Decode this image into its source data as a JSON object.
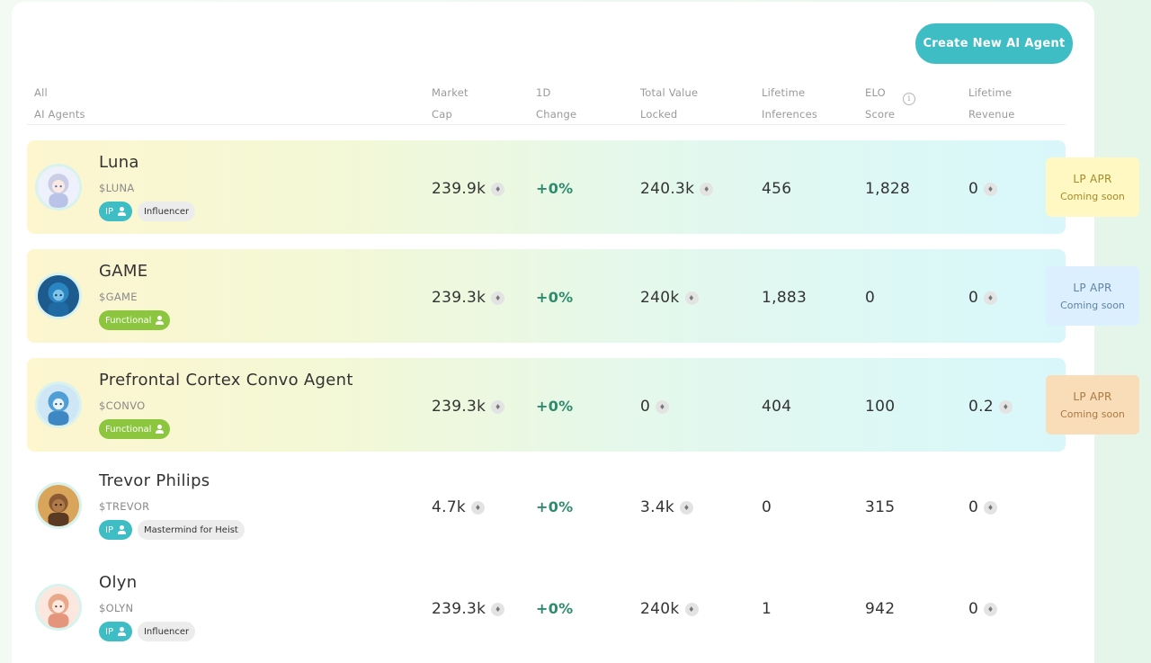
{
  "header": {
    "create_button": "Create New AI Agent",
    "columns": [
      {
        "line1": "All",
        "line2": "AI Agents"
      },
      {
        "line1": "Market",
        "line2": "Cap"
      },
      {
        "line1": "1D",
        "line2": "Change"
      },
      {
        "line1": "Total Value",
        "line2": "Locked"
      },
      {
        "line1": "Lifetime",
        "line2": "Inferences"
      },
      {
        "line1": "ELO",
        "line2": "Score"
      },
      {
        "line1": "Lifetime",
        "line2": "Revenue"
      }
    ],
    "info_glyph": "i"
  },
  "coin_glyph": "♦",
  "agents": [
    {
      "name": "Luna",
      "ticker": "$LUNA",
      "tags": [
        {
          "label": "IP",
          "type": "ip"
        },
        {
          "label": "Influencer",
          "type": "plain"
        }
      ],
      "market_cap": "239.9k",
      "change": "+0%",
      "tvl": "240.3k",
      "inferences": "456",
      "elo": "1,828",
      "revenue": "0",
      "lp": {
        "title": "LP APR",
        "subtitle": "Coming soon",
        "color": "#fff8c2"
      }
    },
    {
      "name": "GAME",
      "ticker": "$GAME",
      "tags": [
        {
          "label": "Functional",
          "type": "func"
        }
      ],
      "market_cap": "239.3k",
      "change": "+0%",
      "tvl": "240k",
      "inferences": "1,883",
      "elo": "0",
      "revenue": "0",
      "lp": {
        "title": "LP APR",
        "subtitle": "Coming soon",
        "color": "#dcefff"
      }
    },
    {
      "name": "Prefrontal Cortex Convo Agent",
      "ticker": "$CONVO",
      "tags": [
        {
          "label": "Functional",
          "type": "func"
        }
      ],
      "market_cap": "239.3k",
      "change": "+0%",
      "tvl": "0",
      "inferences": "404",
      "elo": "100",
      "revenue": "0.2",
      "lp": {
        "title": "LP APR",
        "subtitle": "Coming soon",
        "color": "#f9dcb8"
      }
    },
    {
      "name": "Trevor Philips",
      "ticker": "$TREVOR",
      "tags": [
        {
          "label": "IP",
          "type": "ip"
        },
        {
          "label": "Mastermind for Heist",
          "type": "plain"
        }
      ],
      "market_cap": "4.7k",
      "change": "+0%",
      "tvl": "3.4k",
      "inferences": "0",
      "elo": "315",
      "revenue": "0"
    },
    {
      "name": "Olyn",
      "ticker": "$OLYN",
      "tags": [
        {
          "label": "IP",
          "type": "ip"
        },
        {
          "label": "Influencer",
          "type": "plain"
        }
      ],
      "market_cap": "239.3k",
      "change": "+0%",
      "tvl": "240k",
      "inferences": "1",
      "elo": "942",
      "revenue": "0"
    }
  ],
  "colors": {
    "accent": "#3fbdc4",
    "functional": "#8cc63f",
    "positive": "#2e8b6e"
  }
}
